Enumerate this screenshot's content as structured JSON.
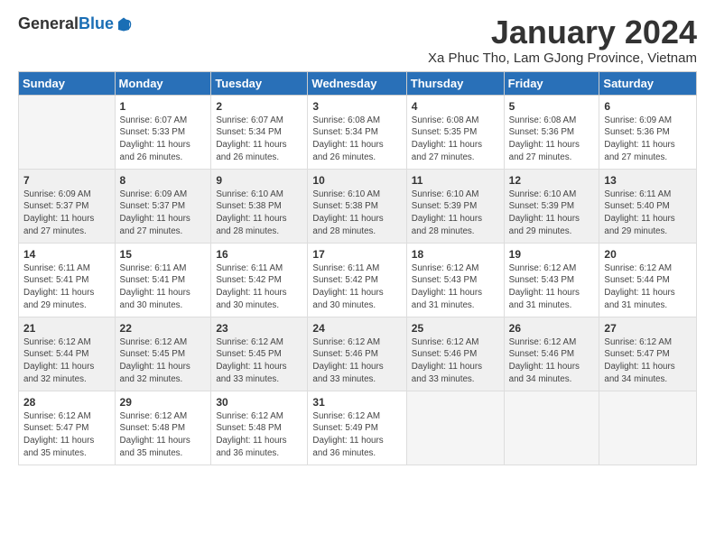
{
  "header": {
    "logo_general": "General",
    "logo_blue": "Blue",
    "title": "January 2024",
    "location": "Xa Phuc Tho, Lam GJong Province, Vietnam"
  },
  "days_of_week": [
    "Sunday",
    "Monday",
    "Tuesday",
    "Wednesday",
    "Thursday",
    "Friday",
    "Saturday"
  ],
  "weeks": [
    [
      {
        "day": "",
        "info": ""
      },
      {
        "day": "1",
        "info": "Sunrise: 6:07 AM\nSunset: 5:33 PM\nDaylight: 11 hours\nand 26 minutes."
      },
      {
        "day": "2",
        "info": "Sunrise: 6:07 AM\nSunset: 5:34 PM\nDaylight: 11 hours\nand 26 minutes."
      },
      {
        "day": "3",
        "info": "Sunrise: 6:08 AM\nSunset: 5:34 PM\nDaylight: 11 hours\nand 26 minutes."
      },
      {
        "day": "4",
        "info": "Sunrise: 6:08 AM\nSunset: 5:35 PM\nDaylight: 11 hours\nand 27 minutes."
      },
      {
        "day": "5",
        "info": "Sunrise: 6:08 AM\nSunset: 5:36 PM\nDaylight: 11 hours\nand 27 minutes."
      },
      {
        "day": "6",
        "info": "Sunrise: 6:09 AM\nSunset: 5:36 PM\nDaylight: 11 hours\nand 27 minutes."
      }
    ],
    [
      {
        "day": "7",
        "info": "Sunrise: 6:09 AM\nSunset: 5:37 PM\nDaylight: 11 hours\nand 27 minutes."
      },
      {
        "day": "8",
        "info": "Sunrise: 6:09 AM\nSunset: 5:37 PM\nDaylight: 11 hours\nand 27 minutes."
      },
      {
        "day": "9",
        "info": "Sunrise: 6:10 AM\nSunset: 5:38 PM\nDaylight: 11 hours\nand 28 minutes."
      },
      {
        "day": "10",
        "info": "Sunrise: 6:10 AM\nSunset: 5:38 PM\nDaylight: 11 hours\nand 28 minutes."
      },
      {
        "day": "11",
        "info": "Sunrise: 6:10 AM\nSunset: 5:39 PM\nDaylight: 11 hours\nand 28 minutes."
      },
      {
        "day": "12",
        "info": "Sunrise: 6:10 AM\nSunset: 5:39 PM\nDaylight: 11 hours\nand 29 minutes."
      },
      {
        "day": "13",
        "info": "Sunrise: 6:11 AM\nSunset: 5:40 PM\nDaylight: 11 hours\nand 29 minutes."
      }
    ],
    [
      {
        "day": "14",
        "info": "Sunrise: 6:11 AM\nSunset: 5:41 PM\nDaylight: 11 hours\nand 29 minutes."
      },
      {
        "day": "15",
        "info": "Sunrise: 6:11 AM\nSunset: 5:41 PM\nDaylight: 11 hours\nand 30 minutes."
      },
      {
        "day": "16",
        "info": "Sunrise: 6:11 AM\nSunset: 5:42 PM\nDaylight: 11 hours\nand 30 minutes."
      },
      {
        "day": "17",
        "info": "Sunrise: 6:11 AM\nSunset: 5:42 PM\nDaylight: 11 hours\nand 30 minutes."
      },
      {
        "day": "18",
        "info": "Sunrise: 6:12 AM\nSunset: 5:43 PM\nDaylight: 11 hours\nand 31 minutes."
      },
      {
        "day": "19",
        "info": "Sunrise: 6:12 AM\nSunset: 5:43 PM\nDaylight: 11 hours\nand 31 minutes."
      },
      {
        "day": "20",
        "info": "Sunrise: 6:12 AM\nSunset: 5:44 PM\nDaylight: 11 hours\nand 31 minutes."
      }
    ],
    [
      {
        "day": "21",
        "info": "Sunrise: 6:12 AM\nSunset: 5:44 PM\nDaylight: 11 hours\nand 32 minutes."
      },
      {
        "day": "22",
        "info": "Sunrise: 6:12 AM\nSunset: 5:45 PM\nDaylight: 11 hours\nand 32 minutes."
      },
      {
        "day": "23",
        "info": "Sunrise: 6:12 AM\nSunset: 5:45 PM\nDaylight: 11 hours\nand 33 minutes."
      },
      {
        "day": "24",
        "info": "Sunrise: 6:12 AM\nSunset: 5:46 PM\nDaylight: 11 hours\nand 33 minutes."
      },
      {
        "day": "25",
        "info": "Sunrise: 6:12 AM\nSunset: 5:46 PM\nDaylight: 11 hours\nand 33 minutes."
      },
      {
        "day": "26",
        "info": "Sunrise: 6:12 AM\nSunset: 5:46 PM\nDaylight: 11 hours\nand 34 minutes."
      },
      {
        "day": "27",
        "info": "Sunrise: 6:12 AM\nSunset: 5:47 PM\nDaylight: 11 hours\nand 34 minutes."
      }
    ],
    [
      {
        "day": "28",
        "info": "Sunrise: 6:12 AM\nSunset: 5:47 PM\nDaylight: 11 hours\nand 35 minutes."
      },
      {
        "day": "29",
        "info": "Sunrise: 6:12 AM\nSunset: 5:48 PM\nDaylight: 11 hours\nand 35 minutes."
      },
      {
        "day": "30",
        "info": "Sunrise: 6:12 AM\nSunset: 5:48 PM\nDaylight: 11 hours\nand 36 minutes."
      },
      {
        "day": "31",
        "info": "Sunrise: 6:12 AM\nSunset: 5:49 PM\nDaylight: 11 hours\nand 36 minutes."
      },
      {
        "day": "",
        "info": ""
      },
      {
        "day": "",
        "info": ""
      },
      {
        "day": "",
        "info": ""
      }
    ]
  ]
}
